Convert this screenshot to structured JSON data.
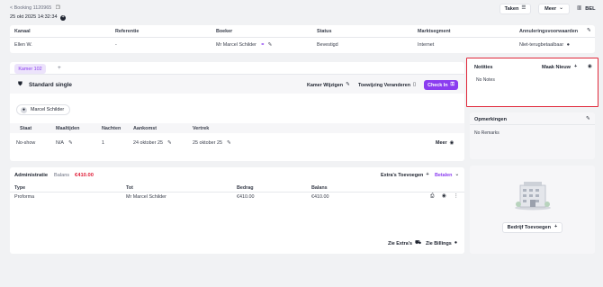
{
  "top": {
    "back_link": "< Booking 1120965",
    "datetime": "25 okt 2025 14:32:34",
    "tasks_button": "Taken",
    "more_button": "Meer",
    "lang": "BEL"
  },
  "booking_table": {
    "headers": [
      "Kanaal",
      "Referentie",
      "Boeker",
      "Status",
      "Marktsegment",
      "Annuleringsvoorwaarden"
    ],
    "row": [
      "Ellen W.",
      "-",
      "Mr Marcel Schilder",
      "Bevestigd",
      "Internet",
      "Niet-terugbetaalbaar"
    ]
  },
  "room": {
    "tab_label": "Kamer 102",
    "add_tab": "+",
    "room_type": "Standard single",
    "change_room": "Kamer Wijzigen",
    "change_assignment": "Toewijzing Veranderen",
    "checkin": "Check In",
    "guest_name": "Marcel Schilder",
    "table_headers": [
      "Staat",
      "Maaltijden",
      "Nachten",
      "Aankomst",
      "Vertrek"
    ],
    "row": [
      "No-show",
      "N/A",
      "1",
      "24 oktober 25",
      "25 oktober 25"
    ],
    "more": "Meer"
  },
  "admin": {
    "title": "Administratie",
    "balance_label": "Balans",
    "balance_value": "€410.00",
    "extras_add": "Extra's Toevoegen",
    "pay": "Betalen",
    "headers": [
      "Type",
      "Tot",
      "Bedrag",
      "Balans"
    ],
    "row": [
      "Proforma",
      "Mr Marcel Schilder",
      "€410.00",
      "€410.00"
    ],
    "see_extras": "Zie Extra's",
    "see_billings": "Zie Billings"
  },
  "notes": {
    "title": "Notities",
    "new": "Maak Nieuw",
    "empty": "No Notes"
  },
  "remarks": {
    "title": "Opmerkingen",
    "empty": "No Remarks"
  },
  "company": {
    "add": "Bedrijf Toevoegen"
  },
  "colors": {
    "accent": "#8b3df0",
    "balance_red": "#e0203a",
    "highlight_border": "#e0283a"
  }
}
